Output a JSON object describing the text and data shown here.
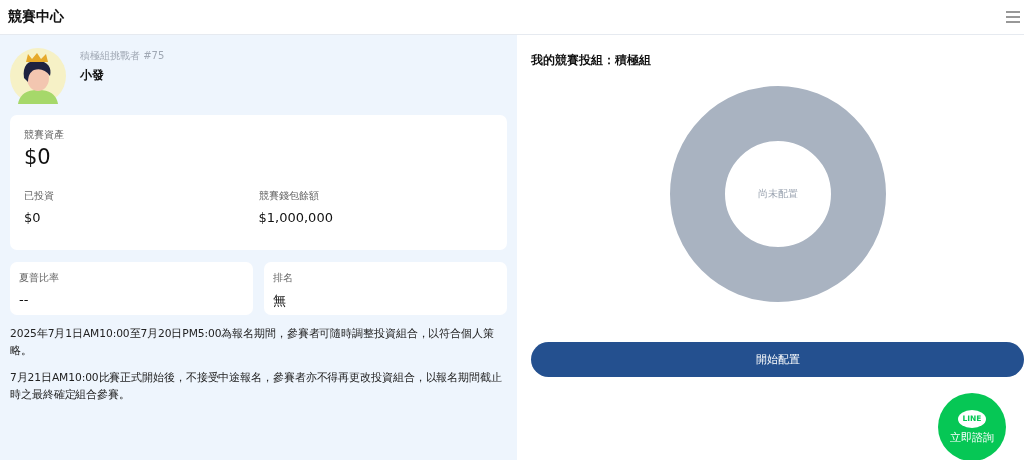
{
  "header": {
    "title": "競賽中心"
  },
  "profile": {
    "subtitle": "積極組挑戰者 #75",
    "name": "小發"
  },
  "asset_card": {
    "label": "競賽資產",
    "value": "$0",
    "items": [
      {
        "label": "已投資",
        "value": "$0"
      },
      {
        "label": "競賽錢包餘額",
        "value": "$1,000,000"
      }
    ]
  },
  "stats": [
    {
      "label": "夏普比率",
      "value": "--"
    },
    {
      "label": "排名",
      "value": "無"
    }
  ],
  "notes": [
    "2025年7月1日AM10:00至7月20日PM5:00為報名期間，參賽者可隨時調整投資組合，以符合個人策略。",
    "7月21日AM10:00比賽正式開始後，不接受中途報名，參賽者亦不得再更改投資組合，以報名期間截止時之最終確定組合參賽。"
  ],
  "portfolio": {
    "title": "我的競賽投組：積極組",
    "center_label": "尚未配置",
    "button": "開始配置"
  },
  "contact": {
    "logo": "LINE",
    "label": "立即諮詢"
  }
}
